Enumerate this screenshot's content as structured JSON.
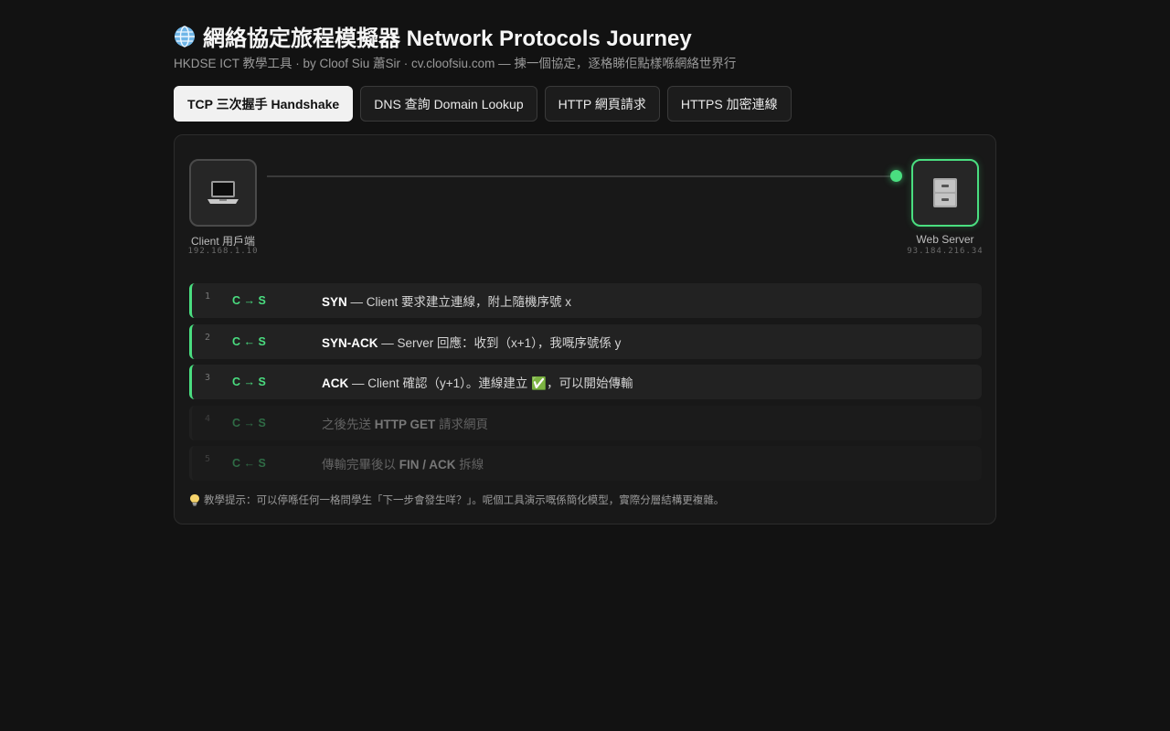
{
  "header": {
    "icon": "globe-icon",
    "title": "網絡協定旅程模擬器 Network Protocols Journey",
    "subtitle": "HKDSE ICT 教學工具 · by Cloof Siu 蕭Sir · cv.cloofsiu.com — 揀一個協定，逐格睇佢點樣喺網絡世界行"
  },
  "tabs": [
    {
      "label": "TCP 三次握手 Handshake",
      "active": true
    },
    {
      "label": "DNS 查詢 Domain Lookup",
      "active": false
    },
    {
      "label": "HTTP 網頁請求",
      "active": false
    },
    {
      "label": "HTTPS 加密連線",
      "active": false
    }
  ],
  "diagram": {
    "client": {
      "icon": "laptop-icon",
      "label": "Client 用戶端",
      "ip": "192.168.1.10"
    },
    "server": {
      "icon": "file-cabinet-icon",
      "label": "Web Server",
      "ip": "93.184.216.34"
    }
  },
  "steps": [
    {
      "num": "1",
      "dir": "C → S",
      "bold": "SYN",
      "text": " — Client 要求建立連線，附上隨機序號 x",
      "done": true
    },
    {
      "num": "2",
      "dir": "C ← S",
      "bold": "SYN-ACK",
      "text": " — Server 回應：收到（x+1），我嘅序號係 y",
      "done": true
    },
    {
      "num": "3",
      "dir": "C → S",
      "bold": "ACK",
      "text": " — Client 確認（y+1）。連線建立 ✅，可以開始傳輸",
      "done": true
    },
    {
      "num": "4",
      "dir": "C → S",
      "pre": "之後先送 ",
      "bold": "HTTP GET",
      "text": " 請求網頁",
      "done": false
    },
    {
      "num": "5",
      "dir": "C ← S",
      "pre": "傳輸完畢後以 ",
      "bold": "FIN / ACK",
      "text": " 拆線",
      "done": false
    }
  ],
  "hint": {
    "icon": "lightbulb-icon",
    "text": "教學提示：可以停喺任何一格問學生「下一步會發生咩？」。呢個工具演示嘅係簡化模型，實際分層結構更複雜。"
  },
  "colors": {
    "accent": "#4ade80",
    "background": "#121212",
    "panel": "#181818"
  }
}
